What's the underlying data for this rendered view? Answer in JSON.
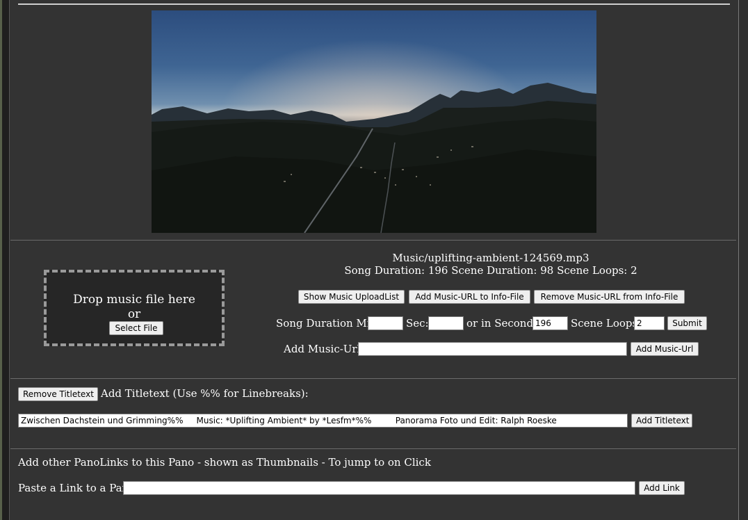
{
  "pano": {
    "alt": "360 degree panorama of an alpine valley at dusk"
  },
  "music": {
    "file_name": "Music/uplifting-ambient-124569.mp3",
    "info_line": "Song Duration: 196 Scene Duration: 98 Scene Loops: 2",
    "dropzone": {
      "title": "Drop music file here",
      "or": "or",
      "select_button": "Select File"
    },
    "buttons": {
      "show_upload_list": "Show Music UploadList",
      "add_url_to_info": "Add Music-URL to Info-File",
      "remove_url_from_info": "Remove Music-URL from Info-File"
    },
    "duration_form": {
      "min_label": "Song Duration Min:",
      "min_value": "",
      "sec_label": "Sec:",
      "sec_value": "",
      "seconds_label": "or in Seconds:",
      "seconds_value": "196",
      "loops_label": "Scene Loops:",
      "loops_value": "2",
      "submit": "Submit"
    },
    "url_form": {
      "label": "Add Music-Url:",
      "value": "",
      "button": "Add Music-Url"
    }
  },
  "titletext": {
    "remove_button": "Remove Titletext",
    "label": "Add Titletext (Use %% for Linebreaks):",
    "value": "Zwischen Dachstein und Grimming%%     Music: *Uplifting Ambient* by *Lesfm*%%         Panorama Foto und Edit: Ralph Roeske",
    "add_button": "Add Titletext"
  },
  "panolinks": {
    "heading": "Add other PanoLinks to this Pano - shown as Thumbnails - To jump to on Click",
    "label": "Paste a Link to a Pano:",
    "value": "",
    "button": "Add Link"
  },
  "colors": {
    "page_bg": "#333333",
    "panel_border": "#6b6b6b",
    "button_bg": "#efefef"
  }
}
